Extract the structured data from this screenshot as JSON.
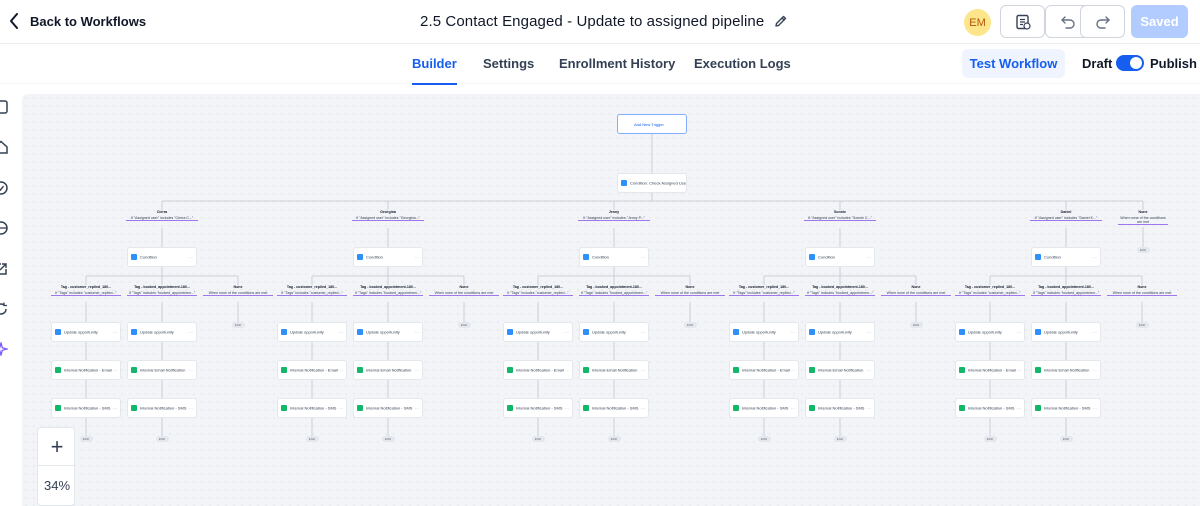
{
  "header": {
    "back_label": "Back to Workflows",
    "title": "2.5 Contact Engaged - Update to assigned pipeline",
    "avatar_initials": "EM",
    "saved_label": "Saved"
  },
  "tabs": [
    {
      "label": "Builder",
      "active": true
    },
    {
      "label": "Settings",
      "active": false
    },
    {
      "label": "Enrollment History",
      "active": false
    },
    {
      "label": "Execution Logs",
      "active": false
    }
  ],
  "toolbar": {
    "test_label": "Test Workflow",
    "draft_label": "Draft",
    "publish_label": "Publish",
    "publish_on": true
  },
  "zoom": {
    "plus_label": "+",
    "level": "34%"
  },
  "colors": {
    "accent": "#155eef",
    "branch_underline": "#9e77ed",
    "action_icon": "#12b76a",
    "opportunity_icon": "#2e90fa",
    "condition_icon": "#2e90fa"
  },
  "workflow": {
    "trigger_label": "Add New Trigger",
    "root_condition": "Condition: Check Assigned User",
    "end_label": "END",
    "top_branches": [
      {
        "name": "Cierra",
        "rule": "If \"Assigned user\" includes \"Cierra C...\""
      },
      {
        "name": "Georgina",
        "rule": "If \"Assigned user\" includes \"Georgina...\""
      },
      {
        "name": "Jenny",
        "rule": "If \"Assigned user\" includes \"Jenny P...\""
      },
      {
        "name": "Sonnie",
        "rule": "If \"Assigned user\" includes \"Sonnie C...\""
      },
      {
        "name": "Daniel",
        "rule": "If \"Assigned user\" includes \"Daniel K...\""
      },
      {
        "name": "None",
        "rule": "When none of the conditions are met"
      }
    ],
    "sub_condition_label": "Condition",
    "sub_branches": [
      {
        "name": "Tag - customer_replied_180...",
        "rule": "If \"Tags\" includes \"customer_replied...\""
      },
      {
        "name": "Tag - booked_appointment-180...",
        "rule": "If \"Tags\" includes \"booked_appointmen...\""
      },
      {
        "name": "None",
        "rule": "When none of the conditions are met"
      }
    ],
    "actions": [
      "Update opportunity",
      "Internal Notification - Email",
      "Internal Notification - SMS"
    ],
    "actions_alt": [
      "Update opportunity",
      "Internal Email Notification",
      "Internal Notification - SMS"
    ]
  }
}
